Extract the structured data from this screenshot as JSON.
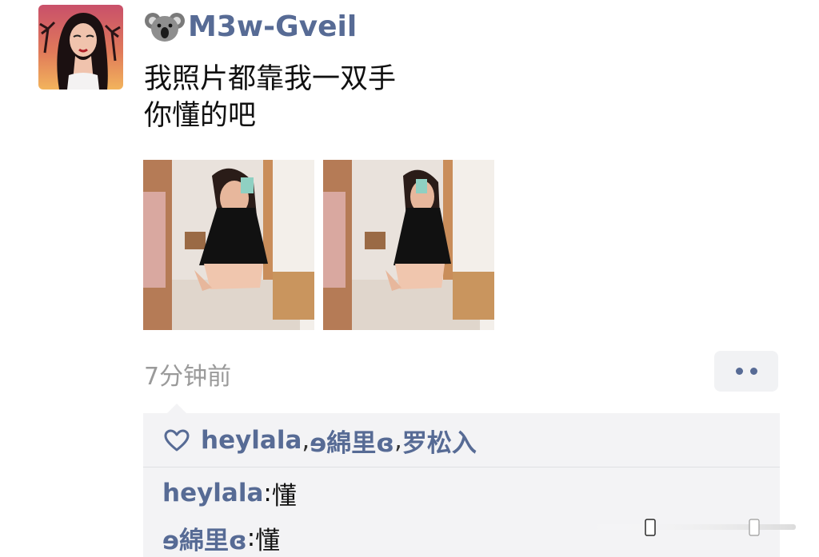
{
  "post": {
    "username": "M3w-Gveil",
    "username_emoji_icon": "koala-emoji-icon",
    "avatar_icon": "profile-avatar",
    "text_lines": [
      "我照片都靠我一双手",
      "你懂的吧"
    ],
    "photos": [
      "photo-1",
      "photo-2"
    ],
    "timestamp": "7分钟前",
    "more_icon": "two-dots-icon"
  },
  "likes": {
    "icon": "heart-outline-icon",
    "names": [
      "heylala",
      "ɘ綿里ɞ",
      "罗松入"
    ],
    "separator": ", "
  },
  "comments": [
    {
      "author": "heylala",
      "colon": ": ",
      "text": "懂"
    },
    {
      "author": "ɘ綿里ɞ",
      "colon": ": ",
      "text": "懂"
    }
  ],
  "colors": {
    "link_blue": "#576b95",
    "timestamp_gray": "#9a9a9a",
    "panel_bg": "#f3f3f5"
  }
}
